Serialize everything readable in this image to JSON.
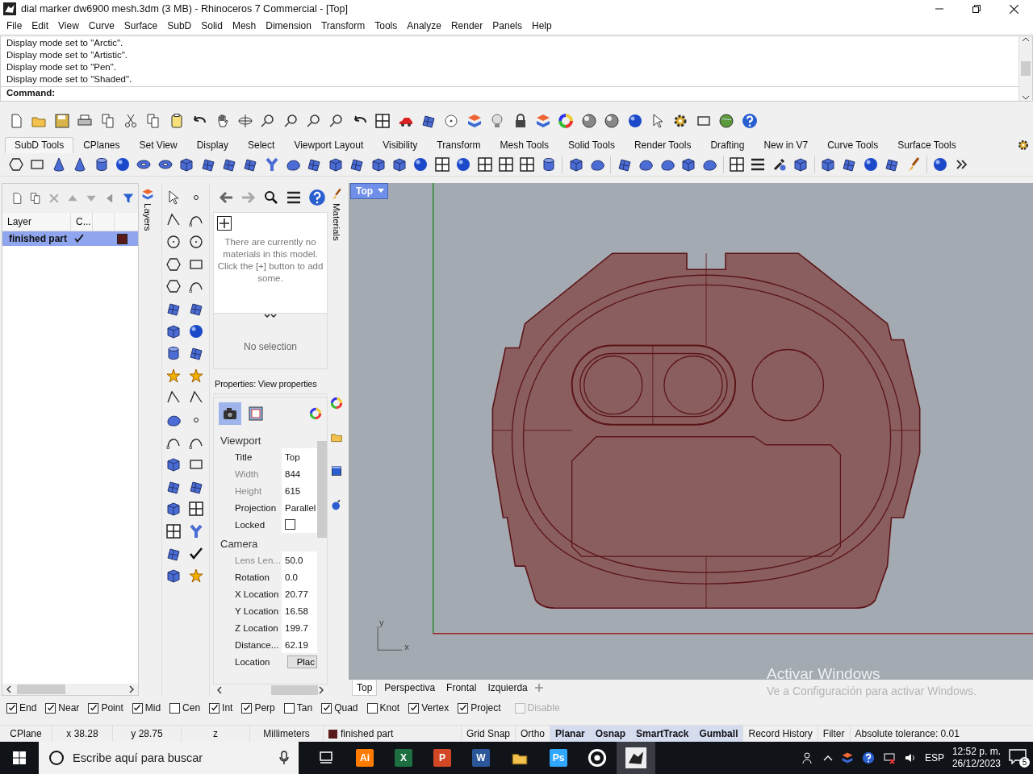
{
  "window": {
    "title": "dial marker dw6900 mesh.3dm (3 MB) - Rhinoceros 7 Commercial - [Top]"
  },
  "menu": [
    "File",
    "Edit",
    "View",
    "Curve",
    "Surface",
    "SubD",
    "Solid",
    "Mesh",
    "Dimension",
    "Transform",
    "Tools",
    "Analyze",
    "Render",
    "Panels",
    "Help"
  ],
  "command_history": [
    "Display mode set to \"Arctic\".",
    "Display mode set to \"Artistic\".",
    "Display mode set to \"Pen\".",
    "Display mode set to \"Shaded\"."
  ],
  "command": {
    "label": "Command:"
  },
  "toolbar_tabs": [
    {
      "label": "SubD Tools",
      "selected": true
    },
    {
      "label": "CPlanes",
      "selected": false
    },
    {
      "label": "Set View",
      "selected": false
    },
    {
      "label": "Display",
      "selected": false
    },
    {
      "label": "Select",
      "selected": false
    },
    {
      "label": "Viewport Layout",
      "selected": false
    },
    {
      "label": "Visibility",
      "selected": false
    },
    {
      "label": "Transform",
      "selected": false
    },
    {
      "label": "Mesh Tools",
      "selected": false
    },
    {
      "label": "Solid Tools",
      "selected": false
    },
    {
      "label": "Render Tools",
      "selected": false
    },
    {
      "label": "Drafting",
      "selected": false
    },
    {
      "label": "New in V7",
      "selected": false
    },
    {
      "label": "Curve Tools",
      "selected": false
    },
    {
      "label": "Surface Tools",
      "selected": false
    }
  ],
  "layers": {
    "tab": "Layers",
    "columns": [
      "Layer",
      "C..."
    ],
    "rows": [
      {
        "name": "finished part",
        "selected": true,
        "current": true,
        "color": "#5a1a1a"
      }
    ]
  },
  "materials": {
    "tab": "Materials",
    "message": "There are currently no materials in this model. Click the [+] button to add some.",
    "selection": "No selection"
  },
  "properties": {
    "title": "Properties: View properties",
    "sections": [
      {
        "heading": "Viewport",
        "rows": [
          {
            "label": "Title",
            "kind": "text",
            "value": "Top",
            "disabled": false
          },
          {
            "label": "Width",
            "kind": "text",
            "value": "844",
            "disabled": true
          },
          {
            "label": "Height",
            "kind": "text",
            "value": "615",
            "disabled": true
          },
          {
            "label": "Projection",
            "kind": "text",
            "value": "Parallel",
            "disabled": false
          },
          {
            "label": "Locked",
            "kind": "checkbox",
            "checked": false,
            "disabled": false
          }
        ]
      },
      {
        "heading": "Camera",
        "rows": [
          {
            "label": "Lens Len...",
            "kind": "text",
            "value": "50.0",
            "disabled": true
          },
          {
            "label": "Rotation",
            "kind": "text",
            "value": "0.0",
            "disabled": false
          },
          {
            "label": "X Location",
            "kind": "text",
            "value": "20.77",
            "disabled": false
          },
          {
            "label": "Y Location",
            "kind": "text",
            "value": "16.58",
            "disabled": false
          },
          {
            "label": "Z Location",
            "kind": "text",
            "value": "199.7",
            "disabled": false
          },
          {
            "label": "Distance...",
            "kind": "text",
            "value": "62.19",
            "disabled": false
          },
          {
            "label": "Location",
            "kind": "button",
            "value": "Plac",
            "disabled": false
          }
        ]
      }
    ]
  },
  "viewport": {
    "label": "Top",
    "axis_x": "x",
    "axis_y": "y"
  },
  "viewport_tabs": [
    {
      "label": "Top",
      "selected": true
    },
    {
      "label": "Perspectiva",
      "selected": false
    },
    {
      "label": "Frontal",
      "selected": false
    },
    {
      "label": "Izquierda",
      "selected": false
    }
  ],
  "activation": {
    "title": "Activar Windows",
    "subtitle": "Ve a Configuración para activar Windows."
  },
  "osnaps": [
    {
      "label": "End",
      "checked": true,
      "disabled": false
    },
    {
      "label": "Near",
      "checked": true,
      "disabled": false
    },
    {
      "label": "Point",
      "checked": true,
      "disabled": false
    },
    {
      "label": "Mid",
      "checked": true,
      "disabled": false
    },
    {
      "label": "Cen",
      "checked": false,
      "disabled": false
    },
    {
      "label": "Int",
      "checked": true,
      "disabled": false
    },
    {
      "label": "Perp",
      "checked": true,
      "disabled": false
    },
    {
      "label": "Tan",
      "checked": false,
      "disabled": false
    },
    {
      "label": "Quad",
      "checked": true,
      "disabled": false
    },
    {
      "label": "Knot",
      "checked": false,
      "disabled": false
    },
    {
      "label": "Vertex",
      "checked": true,
      "disabled": false
    },
    {
      "label": "Project",
      "checked": true,
      "disabled": false
    },
    {
      "label": "Disable",
      "checked": false,
      "disabled": true
    }
  ],
  "status_bar": {
    "cplane": "CPlane",
    "x": "x 38.28",
    "y": "y 28.75",
    "z": "z",
    "units": "Millimeters",
    "layer": {
      "name": "finished part",
      "color": "#5a1a1a"
    },
    "toggles": [
      {
        "label": "Grid Snap",
        "on": false
      },
      {
        "label": "Ortho",
        "on": false
      },
      {
        "label": "Planar",
        "on": true
      },
      {
        "label": "Osnap",
        "on": true
      },
      {
        "label": "SmartTrack",
        "on": true
      },
      {
        "label": "Gumball",
        "on": true
      },
      {
        "label": "Record History",
        "on": false
      },
      {
        "label": "Filter",
        "on": false
      }
    ],
    "tolerance": "Absolute tolerance: 0.01"
  },
  "taskbar": {
    "search_placeholder": "Escribe aquí para buscar",
    "apps": [
      {
        "kind": "grid",
        "selected": false
      },
      {
        "kind": "letter",
        "label": "Ai",
        "color": "#ff7c00",
        "selected": false
      },
      {
        "kind": "letter",
        "label": "X",
        "color": "#1d6f42",
        "selected": false
      },
      {
        "kind": "letter",
        "label": "P",
        "color": "#d24726",
        "selected": false
      },
      {
        "kind": "letter",
        "label": "W",
        "color": "#2b579a",
        "selected": false
      },
      {
        "kind": "folder",
        "selected": false
      },
      {
        "kind": "letter",
        "label": "Ps",
        "color": "#31a8ff",
        "selected": false
      },
      {
        "kind": "ring",
        "selected": false
      },
      {
        "kind": "rhino",
        "selected": true
      }
    ],
    "language": "ESP",
    "time": "12:52 p. m.",
    "date": "26/12/2023",
    "notifications": "5"
  }
}
